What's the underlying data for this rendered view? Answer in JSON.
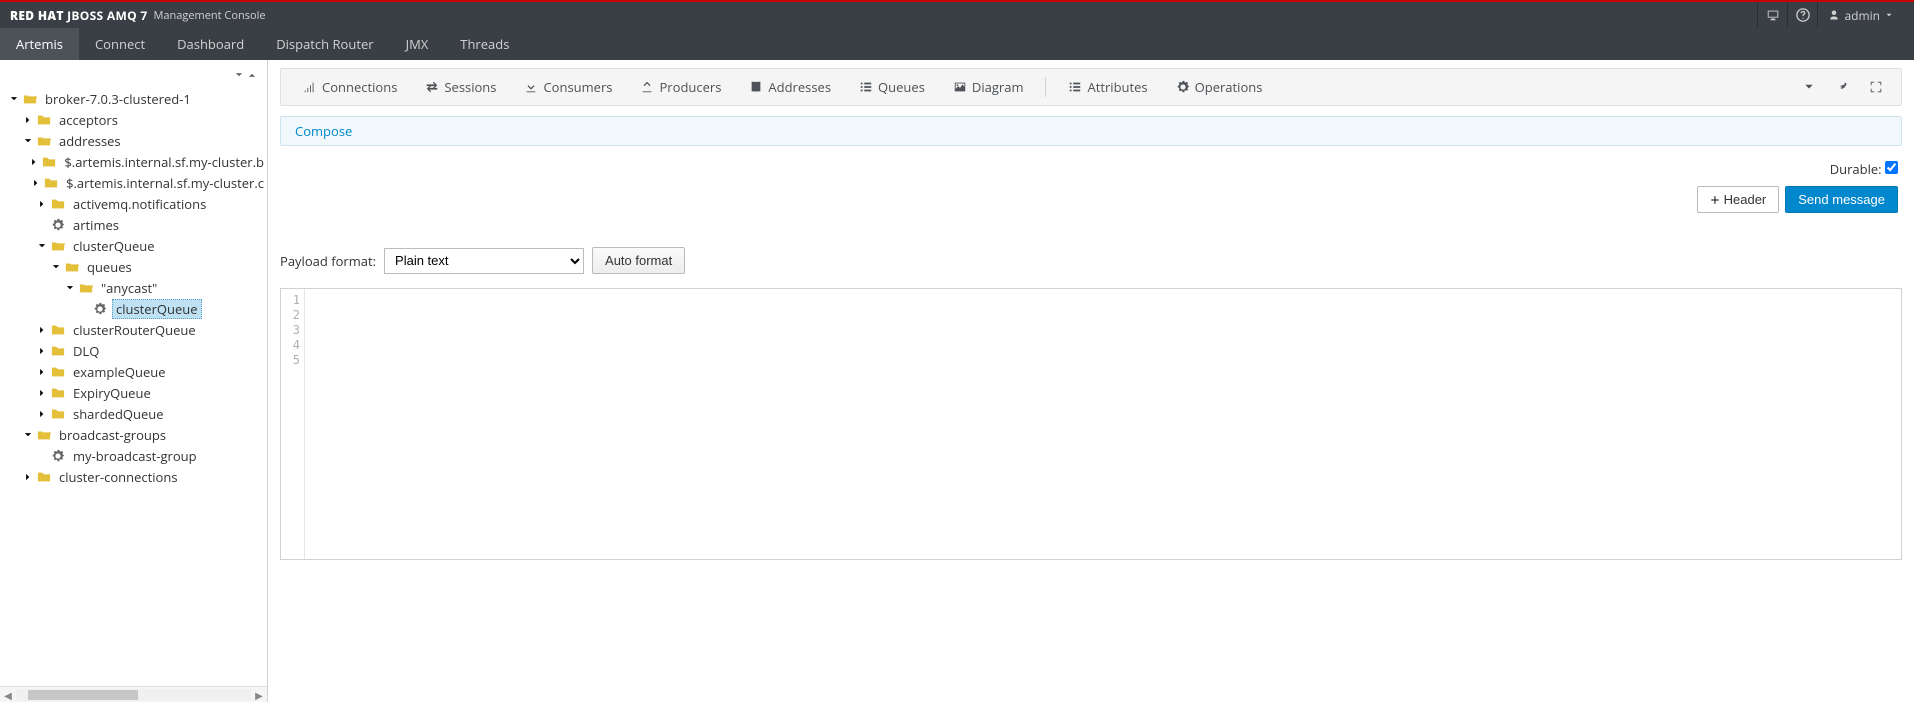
{
  "header": {
    "brand_prefix": "RED HAT ",
    "brand_product": "JBOSS AMQ 7",
    "subtitle": "Management Console",
    "user": "admin"
  },
  "nav": {
    "items": [
      "Artemis",
      "Connect",
      "Dashboard",
      "Dispatch Router",
      "JMX",
      "Threads"
    ],
    "active_index": 0
  },
  "tree": {
    "root": "broker-7.0.3-clustered-1",
    "acceptors": "acceptors",
    "addresses": "addresses",
    "addr_items": {
      "cluster_b": "$.artemis.internal.sf.my-cluster.b",
      "cluster_c": "$.artemis.internal.sf.my-cluster.c",
      "activemq_notif": "activemq.notifications",
      "artimes": "artimes",
      "clusterQueue": "clusterQueue",
      "queues": "queues",
      "anycast": "\"anycast\"",
      "clusterQueue_leaf": "clusterQueue",
      "clusterRouterQueue": "clusterRouterQueue",
      "dlq": "DLQ",
      "exampleQueue": "exampleQueue",
      "expiryQueue": "ExpiryQueue",
      "shardedQueue": "shardedQueue"
    },
    "broadcast_groups": "broadcast-groups",
    "my_broadcast_group": "my-broadcast-group",
    "cluster_connections": "cluster-connections"
  },
  "toolbar": {
    "connections": "Connections",
    "sessions": "Sessions",
    "consumers": "Consumers",
    "producers": "Producers",
    "addresses": "Addresses",
    "queues": "Queues",
    "diagram": "Diagram",
    "attributes": "Attributes",
    "operations": "Operations"
  },
  "subtab": {
    "compose": "Compose"
  },
  "form": {
    "durable_label": "Durable:",
    "durable_checked": true,
    "header_btn": "Header",
    "send_btn": "Send message",
    "payload_label": "Payload format:",
    "payload_value": "Plain text",
    "auto_format": "Auto format",
    "line_numbers": [
      "1",
      "2",
      "3",
      "4",
      "5"
    ]
  }
}
